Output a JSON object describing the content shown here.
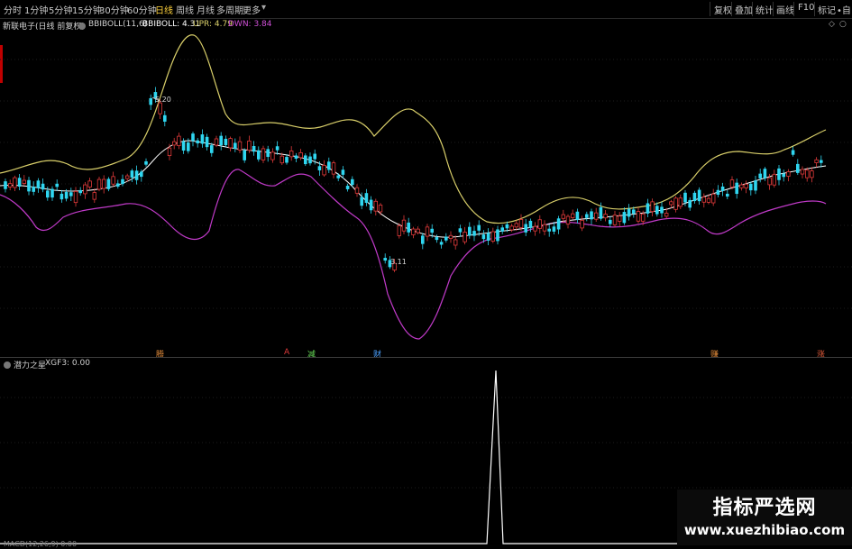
{
  "timeframes": [
    "分时",
    "1分钟",
    "5分钟",
    "15分钟",
    "30分钟",
    "60分钟",
    "日线",
    "周线",
    "月线",
    "多周期",
    "更多"
  ],
  "active_timeframe": "日线",
  "toolbar": [
    "复权",
    "叠加",
    "统计",
    "画线",
    "F10",
    "标记"
  ],
  "toolbar_extra": "•自",
  "main_header": {
    "stock": "新联电子(日线 前复权)",
    "indicator": "BBIBOLL(11,6)",
    "bbiboll_label": "BBIBOLL: 4.31",
    "upr_label": "UPR: 4.79",
    "dwn_label": "DWN: 3.84"
  },
  "price_labels": {
    "high": "5.20",
    "low": "3.11"
  },
  "signals": [
    {
      "text": "腾",
      "color": "#e08a3a"
    },
    {
      "text": "A",
      "color": "#e03a3a"
    },
    {
      "text": "减",
      "color": "#6adf5a"
    },
    {
      "text": "财",
      "color": "#4aa0ff"
    },
    {
      "text": "赚",
      "color": "#e08a3a"
    },
    {
      "text": "涨",
      "color": "#e05a3a"
    }
  ],
  "osc_header": {
    "name": "潜力之星",
    "value": "XGF3: 0.00"
  },
  "bottom_label": "MACD(12,26,9) 0.00",
  "watermark": {
    "line1": "指标严选网",
    "line2": "www.xuezhibiao.com"
  },
  "colors": {
    "up": "#e03a3a",
    "down": "#2fd6f0",
    "mid": "#ffffff",
    "upper": "#d9cf6a",
    "lower": "#c03ac8"
  }
}
